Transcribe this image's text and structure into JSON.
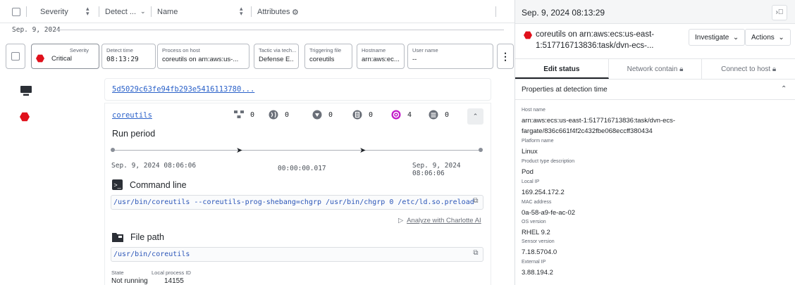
{
  "header": {
    "columns": [
      "Severity",
      "Detect ...",
      "Name",
      "Attributes"
    ]
  },
  "date_divider": "Sep. 9, 2024",
  "chips": [
    {
      "title": "Severity",
      "value": "Critical"
    },
    {
      "title": "Detect time",
      "value": "08:13:29"
    },
    {
      "title": "Process on host",
      "value": "coreutils on arn:aws:us-..."
    },
    {
      "title": "Tactic via tech...",
      "value": "Defense E..."
    },
    {
      "title": "Triggering file",
      "value": "coreutils"
    },
    {
      "title": "Hostname",
      "value": "arn:aws:ec..."
    },
    {
      "title": "User name",
      "value": "--"
    }
  ],
  "parent_card": {
    "hash": "5d5029c63fe94fb293e5416113780..."
  },
  "process_card": {
    "name": "coreutils",
    "stats": [
      "0",
      "0",
      "0",
      "0",
      "4",
      "0"
    ],
    "run_period_label": "Run period",
    "start": "Sep. 9, 2024 08:06:06",
    "duration": "00:00:00.017",
    "end": "Sep. 9, 2024 08:06:06",
    "command_line_label": "Command line",
    "command_line": "/usr/bin/coreutils --coreutils-prog-shebang=chgrp /usr/bin/chgrp 0 /etc/ld.so.preload",
    "charlotte": "Analyze with Charlotte AI",
    "file_path_label": "File path",
    "file_path": "/usr/bin/coreutils",
    "state_label": "State",
    "state_value": "Not running",
    "pid_label": "Local process ID",
    "pid_value": "14155"
  },
  "right_pane": {
    "date": "Sep. 9, 2024 08:13:29",
    "title": "coreutils on arn:aws:ecs:us-east-1:517716713836:task/dvn-ecs-...",
    "investigate": "Investigate",
    "actions": "Actions",
    "tabs": [
      "Edit status",
      "Network contain",
      "Connect to host"
    ],
    "props_heading": "Properties at detection time",
    "props": [
      {
        "k": "Host name",
        "v": [
          "arn:aws:ecs:us-east-1:517716713836:task/dvn-ecs-",
          "fargate/836c661f4f2c432fbe068eccff380434"
        ]
      },
      {
        "k": "Platform name",
        "v": [
          "Linux"
        ]
      },
      {
        "k": "Product type description",
        "v": [
          "Pod"
        ]
      },
      {
        "k": "Local IP",
        "v": [
          "169.254.172.2"
        ]
      },
      {
        "k": "MAC address",
        "v": [
          "0a-58-a9-fe-ac-02"
        ]
      },
      {
        "k": "OS version",
        "v": [
          "RHEL 9.2"
        ]
      },
      {
        "k": "Sensor version",
        "v": [
          "7.18.5704.0"
        ]
      },
      {
        "k": "External IP",
        "v": [
          "3.88.194.2"
        ]
      }
    ]
  },
  "colors": {
    "critical": "#e0101b",
    "link": "#2a61c9",
    "accent_purple": "#c219c8"
  }
}
